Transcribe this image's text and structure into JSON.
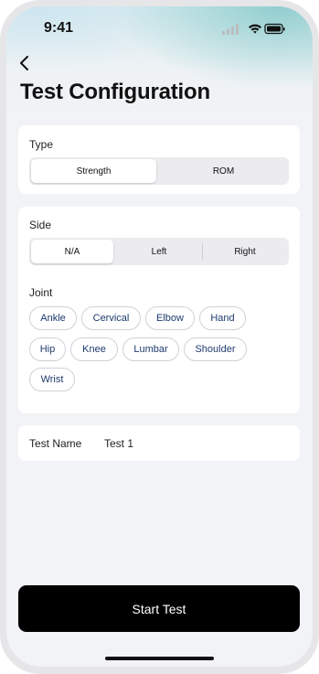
{
  "status_bar": {
    "time": "9:41"
  },
  "header": {
    "title": "Test Configuration"
  },
  "type_section": {
    "label": "Type",
    "options": [
      "Strength",
      "ROM"
    ],
    "selected": "Strength"
  },
  "side_section": {
    "label": "Side",
    "options": [
      "N/A",
      "Left",
      "Right"
    ],
    "selected": "N/A"
  },
  "joint_section": {
    "label": "Joint",
    "options": [
      "Ankle",
      "Cervical",
      "Elbow",
      "Hand",
      "Hip",
      "Knee",
      "Lumbar",
      "Shoulder",
      "Wrist"
    ]
  },
  "test_name": {
    "label": "Test Name",
    "value": "Test 1"
  },
  "start_button": {
    "label": "Start Test"
  },
  "colors": {
    "accent_text": "#1e3a6e",
    "button_bg": "#000000",
    "background": "#f2f3f6"
  }
}
